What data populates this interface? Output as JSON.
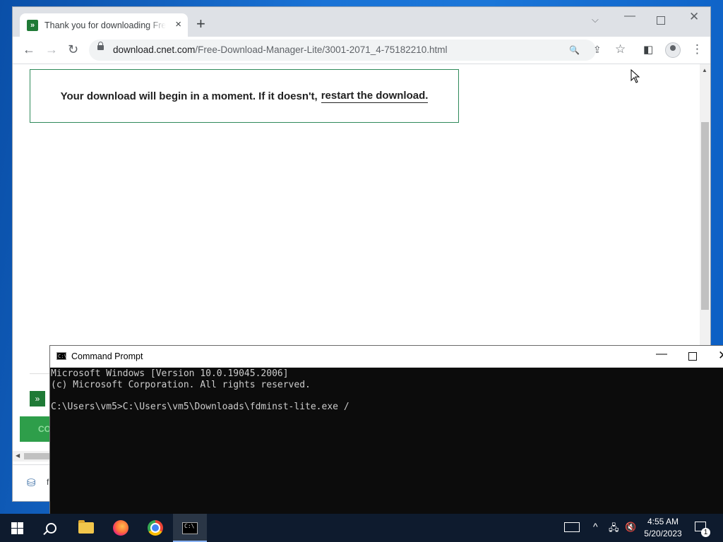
{
  "browser": {
    "tab": {
      "title": "Thank you for downloading Free Download Manager Lite",
      "favicon": "double-chevron-icon",
      "close_icon": "×"
    },
    "new_tab_icon": "+",
    "tab_search_icon": "⌵",
    "window_controls": {
      "minimize": "—",
      "close": "✕"
    },
    "nav": {
      "back": "←",
      "forward": "→",
      "reload": "↻"
    },
    "address": {
      "host": "download.cnet.com",
      "path": "/Free-Download-Manager-Lite/3001-2071_4-75182210.html"
    },
    "omnibox_icons": {
      "search": "🔍",
      "share": "⇪",
      "bookmark": "☆"
    },
    "side_panel_icon": "◧",
    "menu_icon": "⋮",
    "page": {
      "banner_text": "Your download will begin in a moment. If it doesn't,",
      "banner_link": "restart the download.",
      "green_badge": "»",
      "green_button": "CO",
      "shelf_text": "f"
    }
  },
  "cmd": {
    "title": "Command Prompt",
    "controls": {
      "minimize": "—",
      "close": "✕"
    },
    "lines": [
      "Microsoft Windows [Version 10.0.19045.2006]",
      "(c) Microsoft Corporation. All rights reserved.",
      "",
      "C:\\Users\\vm5>C:\\Users\\vm5\\Downloads\\fdminst-lite.exe /"
    ]
  },
  "taskbar": {
    "clock_time": "4:55 AM",
    "clock_date": "5/20/2023",
    "notification_count": "1",
    "tray": {
      "chevron": "^",
      "network": "🖧",
      "volume": "🔇"
    }
  },
  "colors": {
    "banner_border": "#2f8a5a",
    "cnet_green": "#1f7a36",
    "taskbar": "#0e1b2e"
  }
}
